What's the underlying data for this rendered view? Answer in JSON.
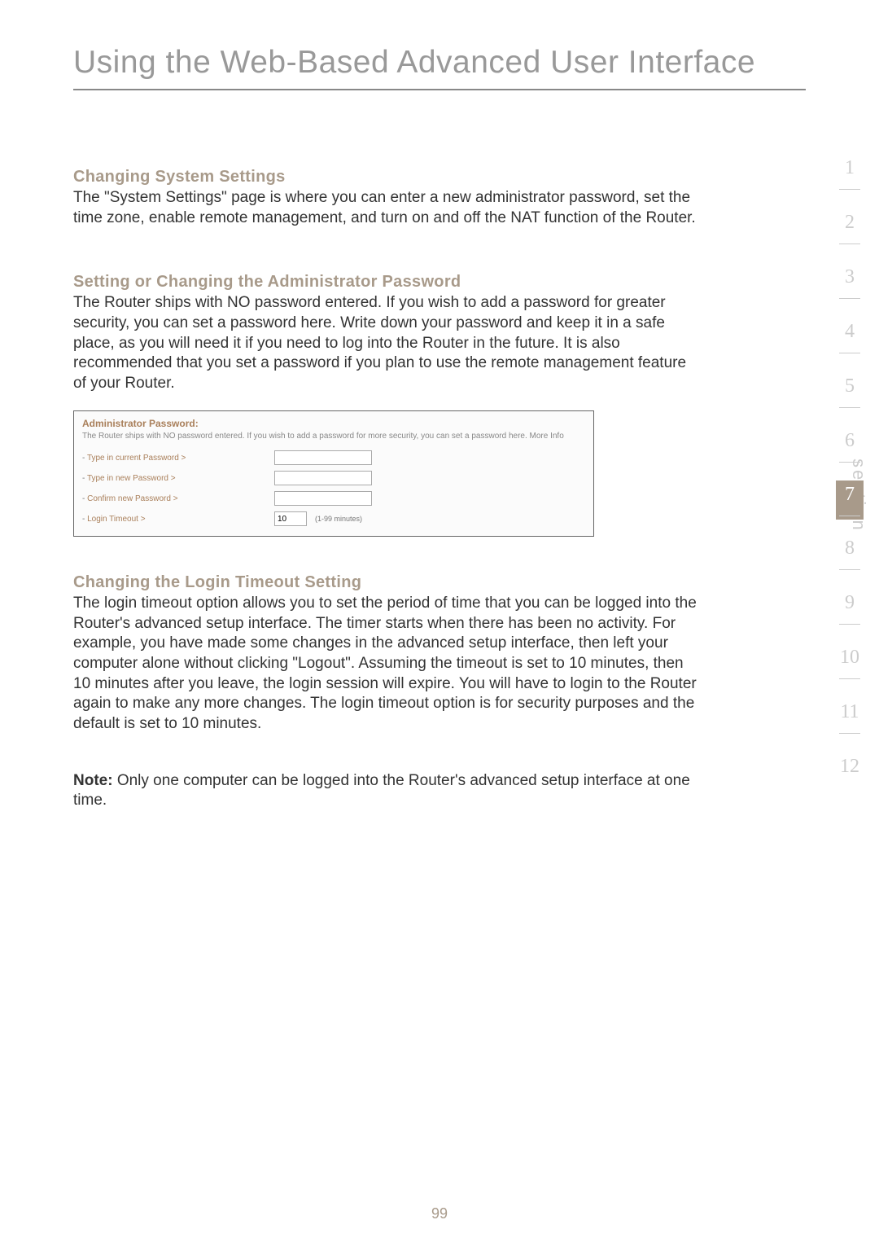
{
  "main_title": "Using the Web-Based Advanced User Interface",
  "section1": {
    "heading": "Changing System Settings",
    "body": "The \"System Settings\" page is where you can enter a new administrator password, set the time zone, enable remote management, and turn on and off the NAT function of the Router."
  },
  "section2": {
    "heading": "Setting or Changing the Administrator Password",
    "body": "The Router ships with NO password entered. If you wish to add a password for greater security, you can set a password here. Write down your password and keep it in a safe place, as you will need it if you need to log into the Router in the future. It is also recommended that you set a password if you plan to use the remote management feature of your Router."
  },
  "screenshot": {
    "title": "Administrator Password:",
    "desc": "The Router ships with NO password entered. If you wish to add a password for more security, you can set a password here. More Info",
    "row_current": "Type in current Password >",
    "row_new": "Type in new Password >",
    "row_confirm": "Confirm new Password >",
    "row_timeout": "Login Timeout >",
    "timeout_value": "10",
    "timeout_hint": "(1-99 minutes)"
  },
  "section3": {
    "heading": "Changing the Login Timeout Setting",
    "body": "The login timeout option allows you to set the period of time that you can be logged into the Router's advanced setup interface. The timer starts when there has been no activity. For example, you have made some changes in the advanced setup interface, then left your computer alone without clicking \"Logout\". Assuming the timeout is set to 10 minutes, then 10 minutes after you leave, the login session will expire. You will have to login to the Router again to make any more changes. The login timeout option is for security purposes and the default is set to 10 minutes."
  },
  "note": {
    "label": "Note:",
    "body": " Only one computer can be logged into the Router's advanced setup interface at one time."
  },
  "sidenav": {
    "label_vertical": "section",
    "items": [
      "1",
      "2",
      "3",
      "4",
      "5",
      "6",
      "7",
      "8",
      "9",
      "10",
      "11",
      "12"
    ],
    "active_index": 6
  },
  "page_number": "99"
}
